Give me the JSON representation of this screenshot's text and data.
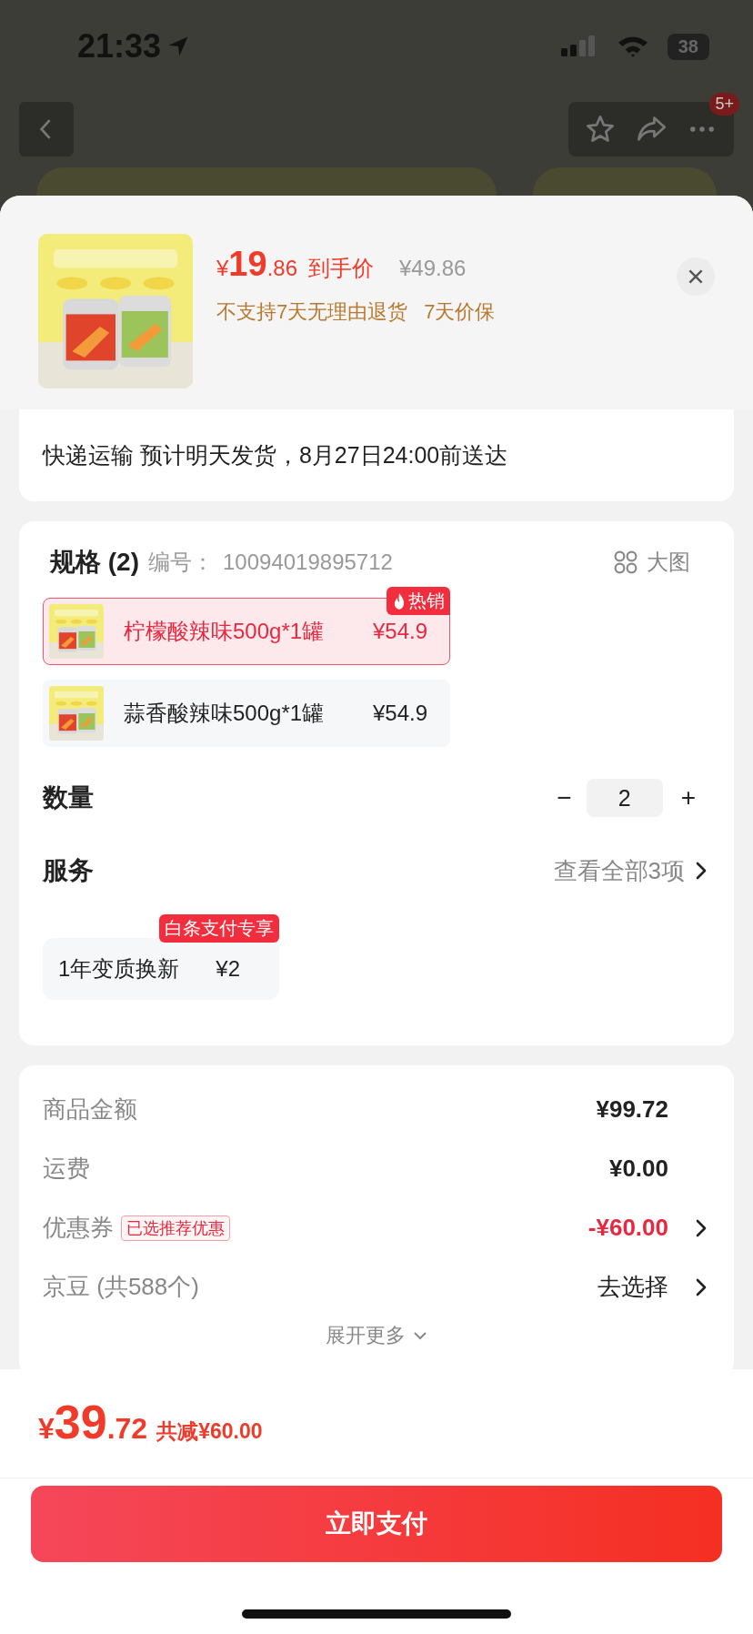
{
  "status_bar": {
    "time": "21:33",
    "battery": "38"
  },
  "nav": {
    "badge": "5+"
  },
  "product": {
    "price_symbol": "¥",
    "price_int": "19",
    "price_dec": ".86",
    "price_label": "到手价",
    "original_price": "¥49.86",
    "notes": [
      "不支持7天无理由退货",
      "7天价保"
    ]
  },
  "shipping": {
    "text": "快递运输 预计明天发货，8月27日24:00前送达"
  },
  "spec": {
    "title": "规格 (2)",
    "code_label": "编号：",
    "code": "10094019895712",
    "view_large": "大图",
    "options": [
      {
        "name": "柠檬酸辣味500g*1罐",
        "price": "¥54.9",
        "selected": true,
        "badge": "热销"
      },
      {
        "name": "蒜香酸辣味500g*1罐",
        "price": "¥54.9",
        "selected": false
      }
    ]
  },
  "quantity": {
    "label": "数量",
    "minus": "−",
    "value": "2",
    "plus": "+"
  },
  "service": {
    "label": "服务",
    "view_all": "查看全部3项",
    "options": [
      {
        "name": "1年变质换新",
        "price": "¥2",
        "badge": "白条支付专享",
        "selected": false
      }
    ]
  },
  "summary": {
    "rows": [
      {
        "kind": "plain",
        "label": "商品金额",
        "value": "¥99.72"
      },
      {
        "kind": "plain",
        "label": "运费",
        "value": "¥0.00"
      },
      {
        "kind": "discount",
        "label": "优惠券",
        "tag": "已选推荐优惠",
        "value": "-¥60.00"
      },
      {
        "kind": "link",
        "label": "京豆 (共588个)",
        "value": "去选择"
      }
    ],
    "expand": "展开更多"
  },
  "footer": {
    "symbol": "¥",
    "int": "39",
    "dec": ".72",
    "saving": "共减¥60.00",
    "pay": "立即支付"
  }
}
